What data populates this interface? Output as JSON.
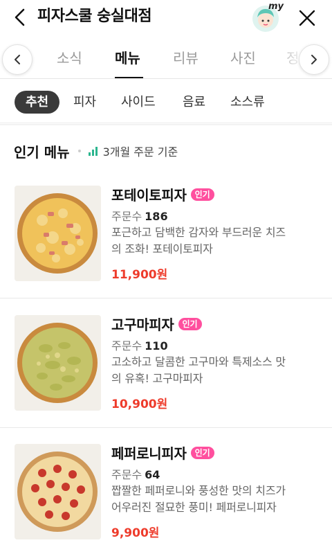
{
  "header": {
    "title": "피자스쿨 숭실대점",
    "avatar_label": "my"
  },
  "tabs": {
    "items": [
      "소식",
      "메뉴",
      "리뷰",
      "사진",
      "정"
    ],
    "active": "메뉴"
  },
  "categories": {
    "items": [
      "추천",
      "피자",
      "사이드",
      "음료",
      "소스류"
    ],
    "active": "추천"
  },
  "popular": {
    "title": "인기 메뉴",
    "basis": "3개월 주문 기준"
  },
  "menu": [
    {
      "name": "포테이토피자",
      "badge": "인기",
      "orders_label": "주문수",
      "orders": "186",
      "desc_line1": "포근하고 담백한 감자와 부드러운 치즈",
      "desc_line2": "의 조화! 포테이토피자",
      "price": "11,900원"
    },
    {
      "name": "고구마피자",
      "badge": "인기",
      "orders_label": "주문수",
      "orders": "110",
      "desc_line1": "고소하고 달콤한 고구마와 특제소스 맛",
      "desc_line2": "의 유혹! 고구마피자",
      "price": "10,900원"
    },
    {
      "name": "페퍼로니피자",
      "badge": "인기",
      "orders_label": "주문수",
      "orders": "64",
      "desc_line1": "짭짤한 페퍼로니와 풍성한 맛의 치즈가",
      "desc_line2": "어우러진 절묘한 풍미! 페퍼로니피자",
      "price": "9,900원"
    }
  ],
  "colors": {
    "price": "#ee3b2b",
    "badge": "#ff4f9e",
    "chip_active": "#3a3a3a"
  }
}
